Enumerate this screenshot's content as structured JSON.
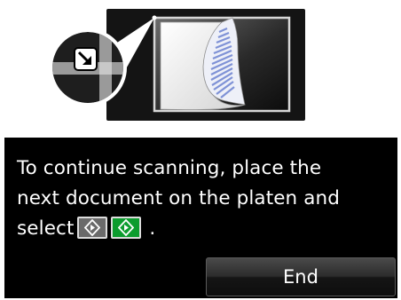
{
  "message": {
    "line1": "To continue scanning, place the",
    "line2": "next document on the platen and",
    "line3_prefix": "select",
    "line3_suffix": "."
  },
  "buttons": {
    "end_label": "End"
  },
  "icons": {
    "mono_start": "black-start-button-icon",
    "color_start": "color-start-button-icon",
    "corner_mark": "corner-alignment-arrow-icon",
    "document": "document-on-platen-icon"
  },
  "colors": {
    "panel_background": "#000000",
    "color_start_key": "#0c9c2e",
    "mono_start_key": "#6a6a6a",
    "document_stripes": "#7f92d6"
  }
}
